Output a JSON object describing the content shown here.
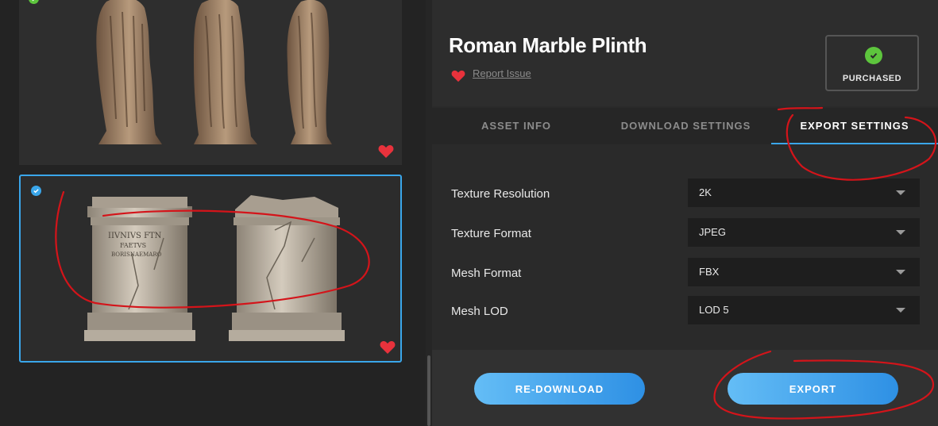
{
  "asset": {
    "title": "Roman Marble Plinth",
    "report_link": "Report Issue",
    "purchased_label": "PURCHASED"
  },
  "tabs": [
    {
      "label": "ASSET INFO",
      "active": false
    },
    {
      "label": "DOWNLOAD SETTINGS",
      "active": false
    },
    {
      "label": "EXPORT SETTINGS",
      "active": true
    }
  ],
  "settings": [
    {
      "label": "Texture Resolution",
      "value": "2K"
    },
    {
      "label": "Texture Format",
      "value": "JPEG"
    },
    {
      "label": "Mesh Format",
      "value": "FBX"
    },
    {
      "label": "Mesh LOD",
      "value": "LOD 5"
    }
  ],
  "buttons": {
    "redownload": "RE-DOWNLOAD",
    "export": "EXPORT"
  },
  "plinth_inscription": [
    "IIVNIVS FTN",
    "FAETVS",
    "BORISNAEMARO"
  ],
  "colors": {
    "accent": "#3aa6ea",
    "favorite": "#e8323c",
    "purchased_check": "#5dc53d",
    "annotation": "#d4141a"
  },
  "icons": [
    "heart-icon",
    "check-icon",
    "chevron-down-icon"
  ]
}
